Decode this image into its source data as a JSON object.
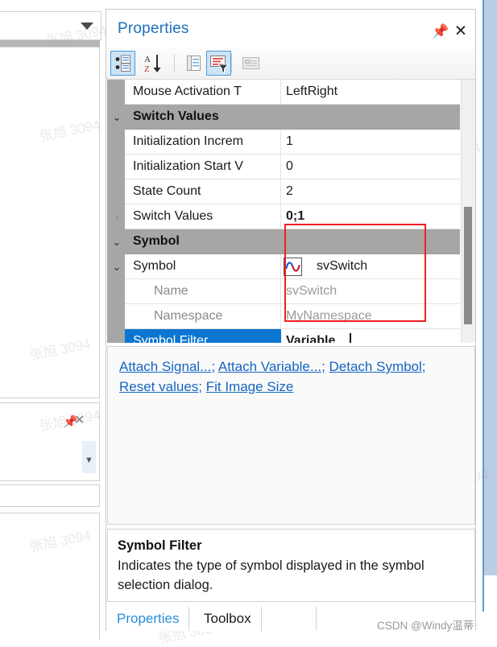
{
  "window": {
    "title": "Properties",
    "pin_icon": "pin-icon",
    "close_icon": "close-icon"
  },
  "toolbar": {
    "buttons": [
      {
        "name": "categorized-button",
        "icon": "categorized-icon",
        "active": true
      },
      {
        "name": "alphabetical-sort-button",
        "icon": "sort-az-icon",
        "active": false
      },
      {
        "name": "property-pages-button",
        "icon": "property-pages-icon",
        "active": false
      },
      {
        "name": "property-filter-button",
        "icon": "filter-icon",
        "active": true
      },
      {
        "name": "events-button",
        "icon": "events-icon",
        "active": false
      }
    ]
  },
  "grid": {
    "rows": [
      {
        "kind": "prop",
        "name": "Mouse Activation T",
        "value": "LeftRight",
        "expander": "",
        "value_style": "normal"
      },
      {
        "kind": "category",
        "name": "Switch Values",
        "value": "",
        "expander": "⌄",
        "value_style": "normal"
      },
      {
        "kind": "prop",
        "name": "Initialization Increm",
        "value": "1",
        "expander": "",
        "value_style": "normal"
      },
      {
        "kind": "prop",
        "name": "Initialization Start V",
        "value": "0",
        "expander": "",
        "value_style": "normal"
      },
      {
        "kind": "prop",
        "name": "State Count",
        "value": "2",
        "expander": "",
        "value_style": "normal"
      },
      {
        "kind": "prop",
        "name": "Switch Values",
        "value": "0;1",
        "expander": "›",
        "value_style": "bold"
      },
      {
        "kind": "category",
        "name": "Symbol",
        "value": "",
        "expander": "⌄",
        "value_style": "normal"
      },
      {
        "kind": "symbol",
        "name": "Symbol",
        "value": "svSwitch",
        "expander": "⌄",
        "value_style": "normal"
      },
      {
        "kind": "child",
        "name": "Name",
        "value": "svSwitch",
        "expander": "",
        "value_style": "muted"
      },
      {
        "kind": "child",
        "name": "Namespace",
        "value": "MyNamespace",
        "expander": "",
        "value_style": "muted"
      },
      {
        "kind": "selected",
        "name": "Symbol Filter",
        "value": "Variable",
        "expander": "",
        "value_style": "bold"
      }
    ],
    "symbol_icon": "sine-wave-icon",
    "dropdown_icon": "chevron-down-icon",
    "highlight_color": "#ef2020",
    "selection_color": "#0b76d1"
  },
  "links": {
    "items": [
      {
        "label": "Attach Signal...",
        "name": "attach-signal-link"
      },
      {
        "label": "Attach Variable...",
        "name": "attach-variable-link"
      },
      {
        "label": "Detach Symbol",
        "name": "detach-symbol-link"
      },
      {
        "label": "Reset values",
        "name": "reset-values-link"
      },
      {
        "label": "Fit Image Size",
        "name": "fit-image-size-link"
      }
    ],
    "separator": "; "
  },
  "description": {
    "title": "Symbol Filter",
    "body": "Indicates the type of symbol displayed in the symbol selection dialog."
  },
  "tabs": [
    {
      "label": "Properties",
      "name": "tab-properties",
      "active": true
    },
    {
      "label": "Toolbox",
      "name": "tab-toolbox",
      "active": false
    }
  ],
  "watermarks": {
    "text": "张旭 3094",
    "csdn": "CSDN @Windy温蒂"
  }
}
